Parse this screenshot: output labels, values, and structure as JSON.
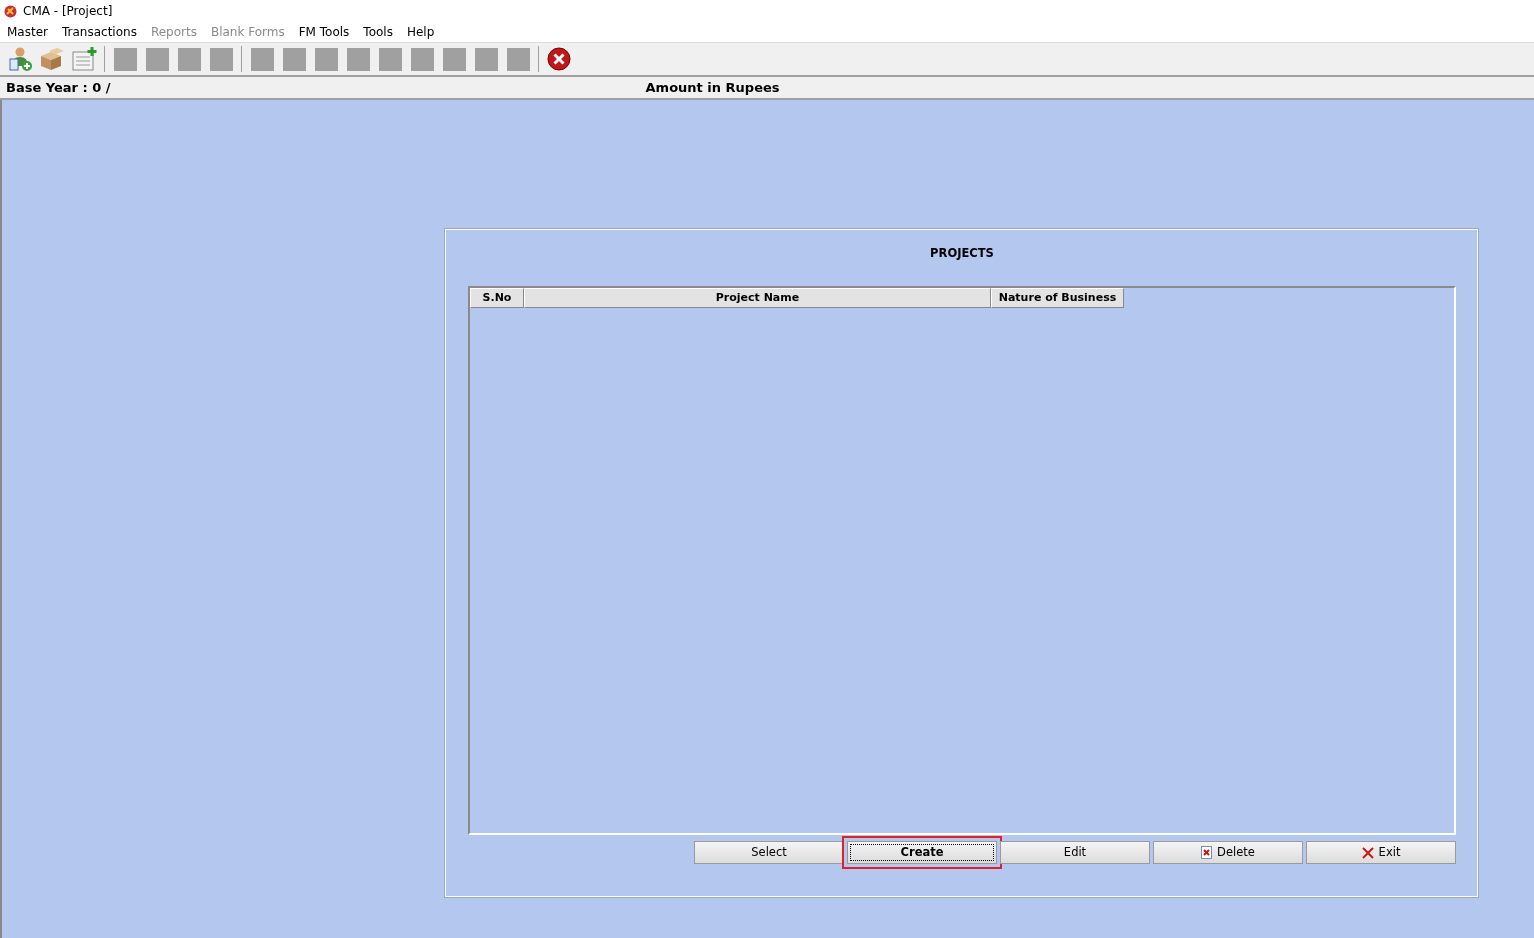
{
  "window": {
    "title": "CMA - [Project]"
  },
  "menu": [
    {
      "label": "Master",
      "disabled": false
    },
    {
      "label": "Transactions",
      "disabled": false
    },
    {
      "label": "Reports",
      "disabled": true
    },
    {
      "label": "Blank Forms",
      "disabled": true
    },
    {
      "label": "FM Tools",
      "disabled": false
    },
    {
      "label": "Tools",
      "disabled": false
    },
    {
      "label": "Help",
      "disabled": false
    }
  ],
  "info_bar": {
    "base_year": "Base Year : 0 /",
    "amount_note": "Amount in Rupees"
  },
  "panel": {
    "title": "PROJECTS",
    "table": {
      "columns": [
        "S.No",
        "Project Name",
        "Nature of Business"
      ]
    },
    "buttons": [
      {
        "label": "Select",
        "kind": "plain",
        "focused": false,
        "highlighted": false
      },
      {
        "label": "Create",
        "kind": "plain",
        "focused": true,
        "highlighted": true
      },
      {
        "label": "Edit",
        "kind": "plain",
        "focused": false,
        "highlighted": false
      },
      {
        "label": "Delete",
        "kind": "delete",
        "focused": false,
        "highlighted": false
      },
      {
        "label": "Exit",
        "kind": "exit",
        "focused": false,
        "highlighted": false
      }
    ]
  }
}
